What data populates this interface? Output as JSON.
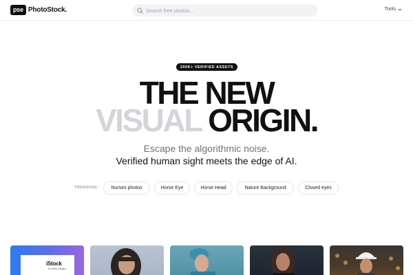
{
  "header": {
    "logo_badge": "pse",
    "logo_text": "PhotoStock.",
    "search_placeholder": "Search free photos...",
    "tools_label": "Tools"
  },
  "hero": {
    "badge": "200K+ VERIFIED ASSETS",
    "title_line1": "THE NEW",
    "title_line2_muted": "VISUAL",
    "title_line2_dark": "ORIGIN.",
    "subtitle_muted": "Escape the algorithmic noise.",
    "subtitle_dark": "Verified human sight meets the edge of AI."
  },
  "trending": {
    "label": "TRENDING:",
    "chips": [
      "Nurses photos",
      "Horse Eye",
      "Horse Head",
      "Nature Background",
      "Closed eyes"
    ]
  },
  "thumbnails": {
    "first_brand": "iStock",
    "first_brand_sub": "by Getty Images"
  }
}
